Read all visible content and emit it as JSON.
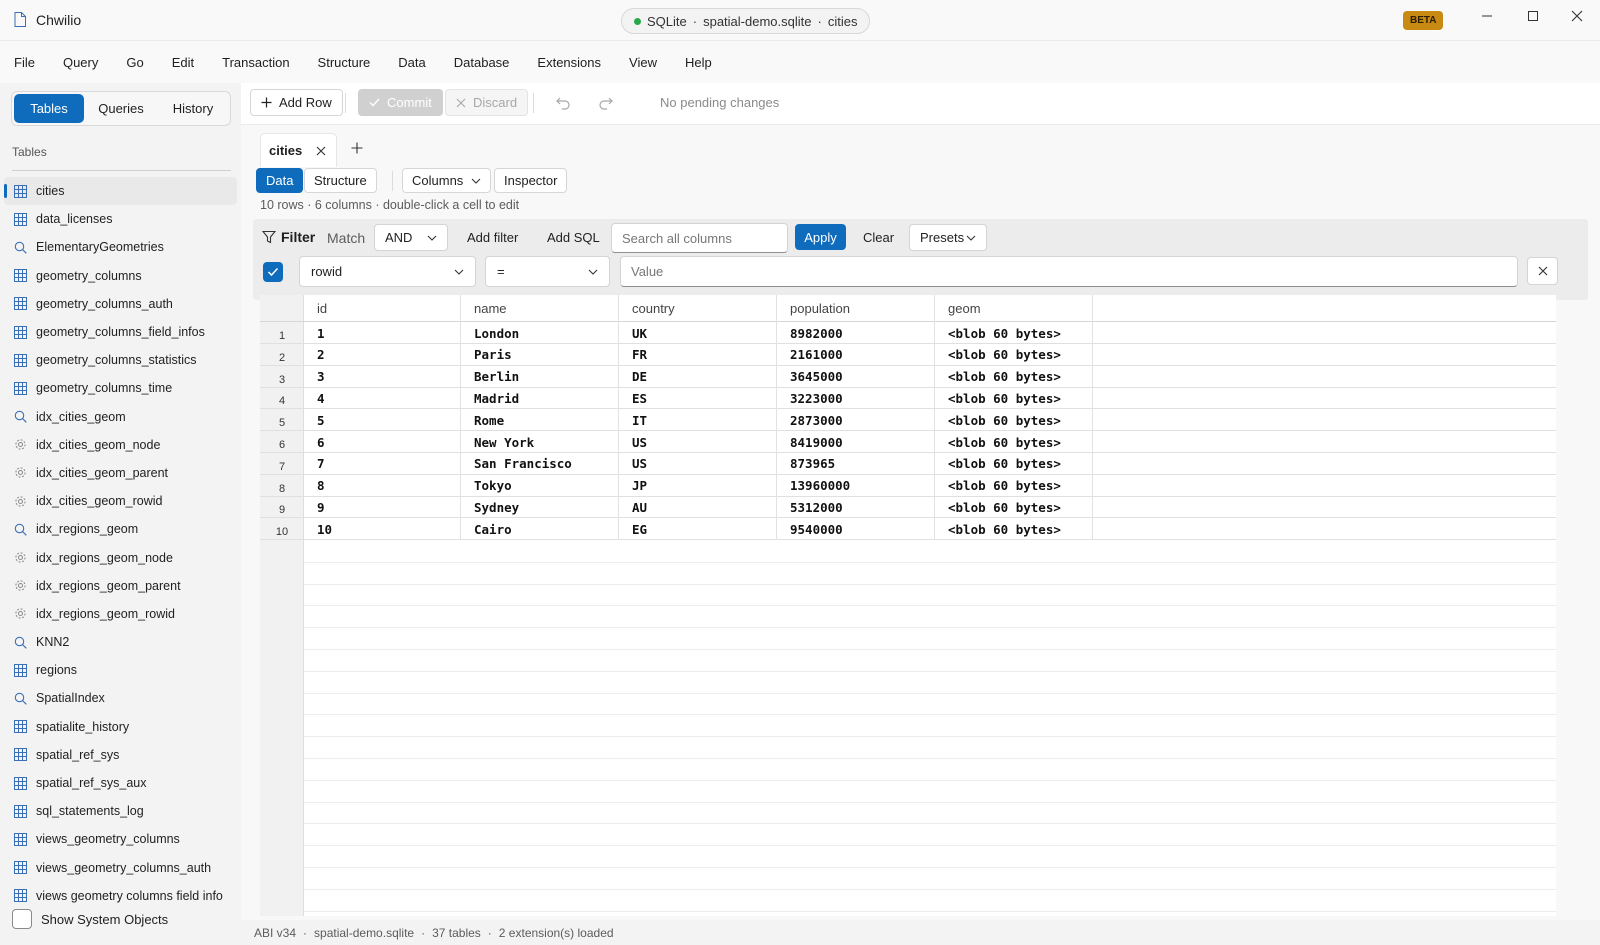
{
  "app": {
    "title": "Chwilio",
    "connection": {
      "engine": "SQLite",
      "file": "spatial-demo.sqlite",
      "table": "cities",
      "separator": "·",
      "status_color": "#2aa84a"
    },
    "badge": "BETA",
    "accent_color": "#0f6cbd",
    "window_controls": [
      "minimize-icon",
      "maximize-icon",
      "close-icon"
    ]
  },
  "menu": [
    "File",
    "Query",
    "Go",
    "Edit",
    "Transaction",
    "Structure",
    "Data",
    "Database",
    "Extensions",
    "View",
    "Help"
  ],
  "sidebar": {
    "tabs": [
      {
        "label": "Tables",
        "active": true
      },
      {
        "label": "Queries",
        "active": false
      },
      {
        "label": "History",
        "active": false
      }
    ],
    "section_label": "Tables",
    "items": [
      {
        "label": "cities",
        "icon": "table-icon",
        "selected": true
      },
      {
        "label": "data_licenses",
        "icon": "table-icon"
      },
      {
        "label": "ElementaryGeometries",
        "icon": "search-icon"
      },
      {
        "label": "geometry_columns",
        "icon": "table-icon"
      },
      {
        "label": "geometry_columns_auth",
        "icon": "table-icon"
      },
      {
        "label": "geometry_columns_field_infos",
        "icon": "table-icon"
      },
      {
        "label": "geometry_columns_statistics",
        "icon": "table-icon"
      },
      {
        "label": "geometry_columns_time",
        "icon": "table-icon"
      },
      {
        "label": "idx_cities_geom",
        "icon": "search-icon"
      },
      {
        "label": "idx_cities_geom_node",
        "icon": "gear-icon"
      },
      {
        "label": "idx_cities_geom_parent",
        "icon": "gear-icon"
      },
      {
        "label": "idx_cities_geom_rowid",
        "icon": "gear-icon"
      },
      {
        "label": "idx_regions_geom",
        "icon": "search-icon"
      },
      {
        "label": "idx_regions_geom_node",
        "icon": "gear-icon"
      },
      {
        "label": "idx_regions_geom_parent",
        "icon": "gear-icon"
      },
      {
        "label": "idx_regions_geom_rowid",
        "icon": "gear-icon"
      },
      {
        "label": "KNN2",
        "icon": "search-icon"
      },
      {
        "label": "regions",
        "icon": "table-icon"
      },
      {
        "label": "SpatialIndex",
        "icon": "search-icon"
      },
      {
        "label": "spatialite_history",
        "icon": "table-icon"
      },
      {
        "label": "spatial_ref_sys",
        "icon": "table-icon"
      },
      {
        "label": "spatial_ref_sys_aux",
        "icon": "table-icon"
      },
      {
        "label": "sql_statements_log",
        "icon": "table-icon"
      },
      {
        "label": "views_geometry_columns",
        "icon": "table-icon"
      },
      {
        "label": "views_geometry_columns_auth",
        "icon": "table-icon"
      },
      {
        "label": "views geometry columns field info",
        "icon": "table-icon"
      }
    ],
    "show_system_objects": {
      "label": "Show System Objects",
      "checked": false
    }
  },
  "toolbar": {
    "add_row": "Add Row",
    "commit": "Commit",
    "discard": "Discard",
    "undo_icon": "undo-icon",
    "redo_icon": "redo-icon",
    "pending": "No pending changes"
  },
  "tabs": [
    {
      "label": "cities"
    }
  ],
  "view": {
    "buttons": [
      "Data",
      "Structure",
      "Columns",
      "Inspector"
    ],
    "active": "Data",
    "summary": "10 rows · 6 columns · double-click a cell to edit"
  },
  "filter": {
    "title": "Filter",
    "match_label": "Match",
    "match_value": "AND",
    "add_filter": "Add filter",
    "add_sql": "Add SQL",
    "search_placeholder": "Search all columns",
    "apply": "Apply",
    "clear": "Clear",
    "presets": "Presets",
    "row": {
      "enabled": true,
      "column": "rowid",
      "operator": "=",
      "value_placeholder": "Value"
    }
  },
  "grid": {
    "columns": [
      "id",
      "name",
      "country",
      "population",
      "geom"
    ],
    "rows": [
      {
        "n": "1",
        "id": "1",
        "name": "London",
        "country": "UK",
        "population": "8982000",
        "geom": "<blob 60 bytes>"
      },
      {
        "n": "2",
        "id": "2",
        "name": "Paris",
        "country": "FR",
        "population": "2161000",
        "geom": "<blob 60 bytes>"
      },
      {
        "n": "3",
        "id": "3",
        "name": "Berlin",
        "country": "DE",
        "population": "3645000",
        "geom": "<blob 60 bytes>"
      },
      {
        "n": "4",
        "id": "4",
        "name": "Madrid",
        "country": "ES",
        "population": "3223000",
        "geom": "<blob 60 bytes>"
      },
      {
        "n": "5",
        "id": "5",
        "name": "Rome",
        "country": "IT",
        "population": "2873000",
        "geom": "<blob 60 bytes>"
      },
      {
        "n": "6",
        "id": "6",
        "name": "New York",
        "country": "US",
        "population": "8419000",
        "geom": "<blob 60 bytes>"
      },
      {
        "n": "7",
        "id": "7",
        "name": "San Francisco",
        "country": "US",
        "population": "873965",
        "geom": "<blob 60 bytes>"
      },
      {
        "n": "8",
        "id": "8",
        "name": "Tokyo",
        "country": "JP",
        "population": "13960000",
        "geom": "<blob 60 bytes>"
      },
      {
        "n": "9",
        "id": "9",
        "name": "Sydney",
        "country": "AU",
        "population": "5312000",
        "geom": "<blob 60 bytes>"
      },
      {
        "n": "10",
        "id": "10",
        "name": "Cairo",
        "country": "EG",
        "population": "9540000",
        "geom": "<blob 60 bytes>"
      }
    ]
  },
  "status": {
    "abi": "ABI v34",
    "file": "spatial-demo.sqlite",
    "tables": "37 tables",
    "extensions": "2 extension(s) loaded",
    "separator": "·"
  }
}
